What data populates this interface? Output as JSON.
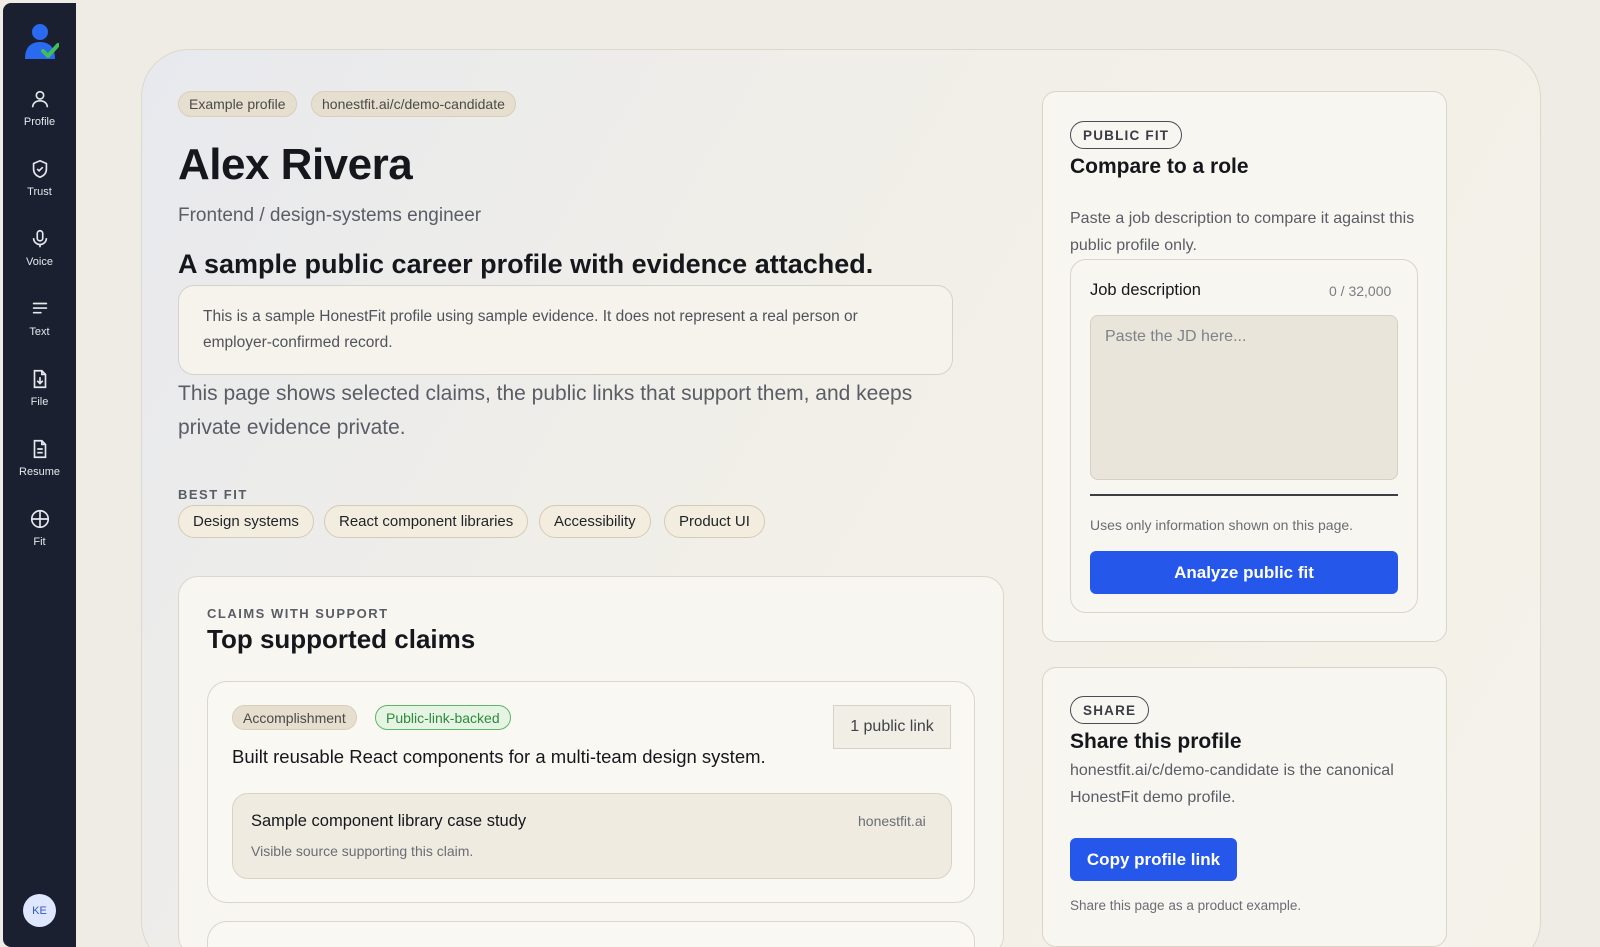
{
  "sidebar": {
    "logo": "user-check-logo",
    "items": [
      {
        "label": "Profile",
        "icon": "user-icon"
      },
      {
        "label": "Trust",
        "icon": "shield-check-icon"
      },
      {
        "label": "Voice",
        "icon": "microphone-icon"
      },
      {
        "label": "Text",
        "icon": "text-lines-icon"
      },
      {
        "label": "File",
        "icon": "file-download-icon"
      },
      {
        "label": "Resume",
        "icon": "document-icon"
      },
      {
        "label": "Fit",
        "icon": "crosshair-circle-icon"
      }
    ],
    "avatar_initials": "KE"
  },
  "profile": {
    "pills": [
      "Example profile",
      "honestfit.ai/c/demo-candidate"
    ],
    "name": "Alex Rivera",
    "role": "Frontend / design-systems engineer",
    "headline": "A sample public career profile with evidence attached.",
    "notice": "This is a sample HonestFit profile using sample evidence. It does not represent a real person or employer-confirmed record.",
    "intro": "This page shows selected claims, the public links that support them, and keeps private evidence private.",
    "best_fit_label": "BEST FIT",
    "best_fit": [
      "Design systems",
      "React component libraries",
      "Accessibility",
      "Product UI"
    ]
  },
  "claims": {
    "eyebrow": "CLAIMS WITH SUPPORT",
    "title": "Top supported claims",
    "items": [
      {
        "type": "Accomplishment",
        "status": "Public-link-backed",
        "links": "1 public link",
        "text": "Built reusable React components for a multi-team design system.",
        "evidence": {
          "title": "Sample component library case study",
          "domain": "honestfit.ai",
          "desc": "Visible source supporting this claim."
        }
      }
    ]
  },
  "fit_panel": {
    "eyebrow": "PUBLIC FIT",
    "title": "Compare to a role",
    "desc": "Paste a job description to compare it against this public profile only.",
    "jd_label": "Job description",
    "jd_count": "0 / 32,000",
    "jd_placeholder": "Paste the JD here...",
    "jd_value": "",
    "note": "Uses only information shown on this page.",
    "button": "Analyze public fit"
  },
  "share_panel": {
    "eyebrow": "SHARE",
    "title": "Share this profile",
    "desc": "honestfit.ai/c/demo-candidate is the canonical HonestFit demo profile.",
    "button": "Copy profile link",
    "note": "Share this page as a product example."
  },
  "colors": {
    "sidebar_bg": "#1a2030",
    "accent": "#2557eb",
    "success": "#2f8a3d",
    "page_bg": "#eeece4"
  }
}
